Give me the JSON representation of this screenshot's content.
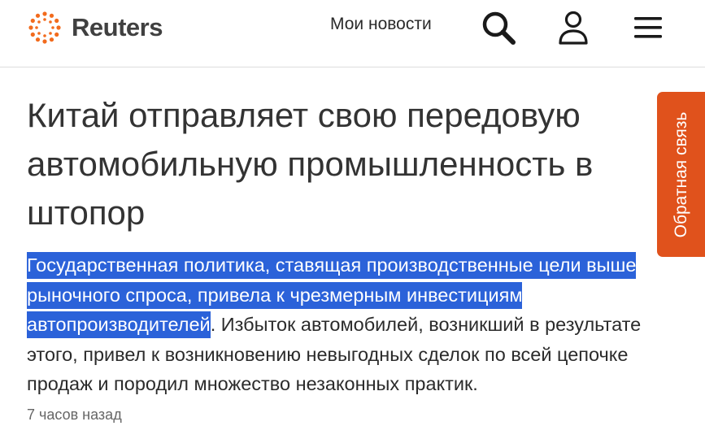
{
  "header": {
    "logo_text": "Reuters",
    "logo_icon": "reuters-dot-ring-logo",
    "my_news_label": "Мои новости",
    "icons": {
      "search": "search-icon",
      "account": "user-icon",
      "menu": "hamburger-menu-icon"
    }
  },
  "article": {
    "headline": "Китай отправляет свою передовую автомобильную промышленность в штопор",
    "summary_highlighted": "Государственная политика, ставящая производственные цели выше рыночного спроса, привела к чрезмерным инвестициям автопроизводителей",
    "summary_rest": ". Избыток автомобилей, возникший в результате этого, привел к возникновению невыгодных сделок по всей цепочке продаж и породил множество незаконных практик.",
    "timestamp": "7 часов назад"
  },
  "feedback": {
    "label": "Обратная связь"
  },
  "colors": {
    "brand_orange": "#e0521c",
    "selection_blue": "#2b62d9",
    "text_dark": "#333333",
    "divider": "#dcdcdc"
  }
}
